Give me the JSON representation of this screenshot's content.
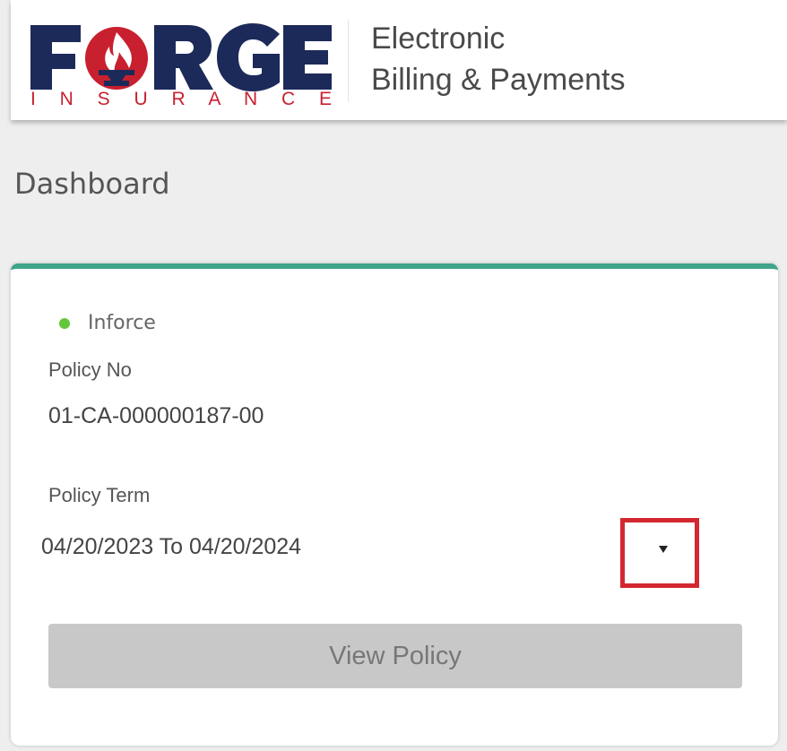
{
  "header": {
    "logo": {
      "wordmark": "FORGE",
      "tagline": "INSURANCE"
    },
    "app_title_line1": "Electronic",
    "app_title_line2": "Billing & Payments"
  },
  "page_title": "Dashboard",
  "policy_card": {
    "status": "Inforce",
    "policy_no_label": "Policy No",
    "policy_no": "01-CA-000000187-00",
    "policy_term_label": "Policy Term",
    "policy_term": "04/20/2023 To 04/20/2024",
    "view_policy_label": "View Policy"
  },
  "colors": {
    "brand_navy": "#1c2a5a",
    "brand_red": "#c8202f",
    "card_accent": "#3fa58a",
    "status_active": "#62c73a",
    "highlight_box": "#d3282f"
  },
  "icons": {
    "status_indicator": "green-dot-icon",
    "dropdown": "caret-down-icon"
  }
}
